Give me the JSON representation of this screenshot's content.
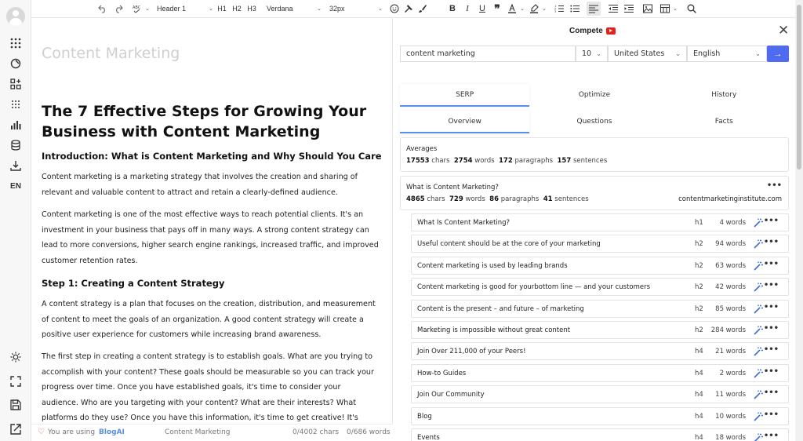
{
  "toolbar": {
    "block_type": "Header 1",
    "h1": "H1",
    "h2": "H2",
    "h3": "H3",
    "font": "Verdana",
    "size": "32px"
  },
  "rail": {
    "lang": "EN"
  },
  "editor": {
    "doc_title": "Content Marketing",
    "h1": "The 7 Effective Steps for Growing Your Business with Content Marketing",
    "intro_heading": "Introduction: What is Content Marketing and Why Should You Care",
    "p1": "Content marketing is a marketing strategy that involves the creation and sharing of relevant and valuable content to attract and retain a clearly-defined audience.",
    "p2": "Content marketing is one of the most effective ways to reach potential clients. It's an investment in your business that pays off in many ways. A strong content strategy can lead to more conversions, higher search engine rankings, increased traffic, and improved customer retention rates.",
    "step1_heading": "Step 1: Creating a Content Strategy",
    "p3": "A content strategy is a plan that focuses on the creation, distribution, and measurement of content to meet the goals of an organization. A good content strategy will create a positive user experience for customers while increasing brand awareness.",
    "p4": "The first step in creating a content strategy is to establish goals. What are you trying to accomplish with your content? These goals should be measurable so you can track your progress over time. Once you have established goals, it's time to consider your audience. Who are you targeting with your content? What are their interests? What platforms do they use? Once you have this information, it's time to get creative! It's important not only to think"
  },
  "footer": {
    "using": "You are using",
    "brand": "BlogAI",
    "doc": "Content Marketing",
    "chars": "0/4002 chars",
    "words": "0/686 words"
  },
  "panel": {
    "title": "Compete",
    "keyword": "content marketing",
    "count": "10",
    "country": "United States",
    "language": "English",
    "tabs": [
      "SERP",
      "Optimize",
      "History"
    ],
    "subtabs": [
      "Overview",
      "Questions",
      "Facts"
    ],
    "averages": {
      "label": "Averages",
      "chars": "17553",
      "words": "2754",
      "paragraphs": "172",
      "sentences": "157"
    },
    "result": {
      "title": "What is Content Marketing?",
      "chars": "4865",
      "words": "729",
      "paragraphs": "86",
      "sentences": "41",
      "url": "contentmarketinginstitute.com"
    },
    "unit_labels": {
      "chars": "chars",
      "words": "words",
      "paragraphs": "paragraphs",
      "sentences": "sentences"
    },
    "headings": [
      {
        "text": "What Is Content Marketing?",
        "level": "h1",
        "words": "4 words"
      },
      {
        "text": "Useful content should be at the core of your marketing",
        "level": "h2",
        "words": "94 words"
      },
      {
        "text": "Content marketing is used by leading brands",
        "level": "h2",
        "words": "63 words"
      },
      {
        "text": "Content marketing is good for yourbottom line — and your customers",
        "level": "h2",
        "words": "42 words"
      },
      {
        "text": "Content is the present – and future – of marketing",
        "level": "h2",
        "words": "85 words"
      },
      {
        "text": "Marketing is impossible without great content",
        "level": "h2",
        "words": "284 words"
      },
      {
        "text": "Join Over 211,000 of your Peers!",
        "level": "h4",
        "words": "21 words"
      },
      {
        "text": "How-to Guides",
        "level": "h4",
        "words": "2 words"
      },
      {
        "text": "Join Our Community",
        "level": "h4",
        "words": "11 words"
      },
      {
        "text": "Blog",
        "level": "h4",
        "words": "10 words"
      },
      {
        "text": "Events",
        "level": "h4",
        "words": "18 words"
      }
    ],
    "colors": {
      "accent": "#4f6cf0",
      "tab_underline": "#5b8def",
      "youtube": "#e62117"
    }
  }
}
